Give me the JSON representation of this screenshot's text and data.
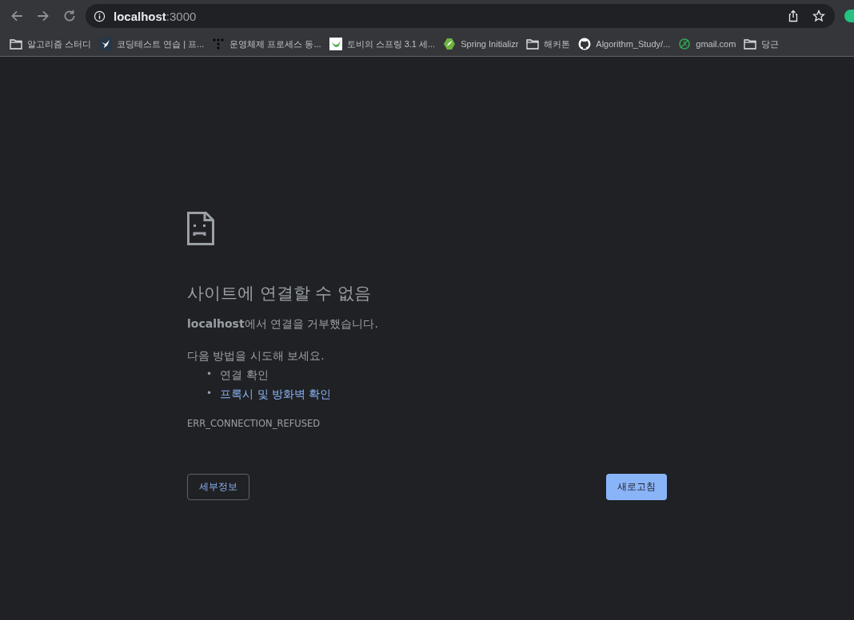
{
  "address_bar": {
    "host": "localhost",
    "port": ":3000"
  },
  "bookmarks": [
    {
      "kind": "folder",
      "label": "알고리즘 스터디"
    },
    {
      "kind": "site",
      "label": "코딩테스트 연습 | 프..."
    },
    {
      "kind": "site",
      "label": "운영체제 프로세스 동..."
    },
    {
      "kind": "site",
      "label": "토비의 스프링 3.1 세..."
    },
    {
      "kind": "site",
      "label": "Spring Initializr"
    },
    {
      "kind": "folder",
      "label": "해커톤"
    },
    {
      "kind": "site",
      "label": "Algorithm_Study/..."
    },
    {
      "kind": "site",
      "label": "gmail.com"
    },
    {
      "kind": "folder",
      "label": "당근"
    }
  ],
  "error": {
    "title": "사이트에 연결할 수 없음",
    "message": "**localhost**에서 연결을 거부했습니다.",
    "suggestion_intro": "다음 방법을 시도해 보세요.",
    "suggestions": [
      {
        "kind": "text",
        "bullet": "•",
        "label": "연결 확인"
      },
      {
        "kind": "link",
        "bullet": "•",
        "label": "프록시 및 방화벽 확인"
      }
    ],
    "code": "ERR_CONNECTION_REFUSED"
  },
  "buttons": {
    "details": "세부정보",
    "reload": "새로고침"
  }
}
